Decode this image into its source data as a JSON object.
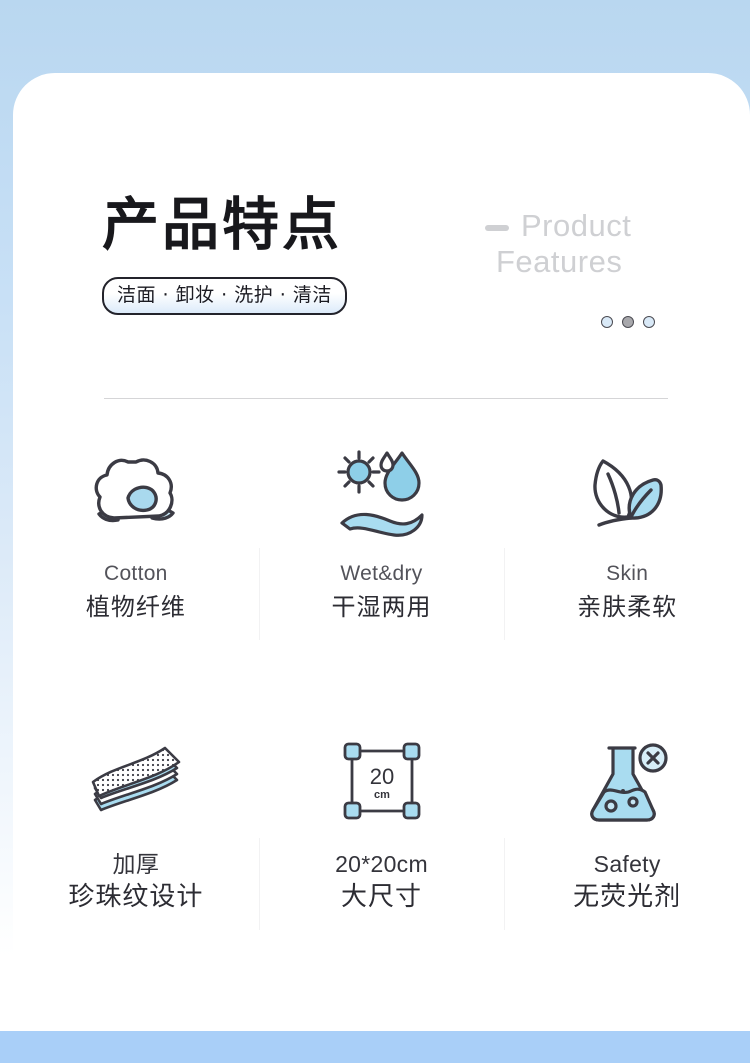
{
  "colors": {
    "page_gradient_top": "#b9d7f0",
    "page_gradient_bottom": "#ffffff",
    "bottom_band": "#a9cff8",
    "card": "#ffffff",
    "accent_blue": "#9ed2ea",
    "accent_blue_light": "#c6e6f4",
    "outline_dark": "#3b3b44",
    "title_text": "#18181c",
    "title_en_text": "#cfd0d3",
    "divider": "#d5d5d7"
  },
  "header": {
    "title_cn": "产品特点",
    "title_en_line1": "Product",
    "title_en_line2": "Features",
    "badge_text": "洁面 · 卸妆 · 洗护 · 清洁",
    "dots": [
      {
        "name": "dot-1",
        "style": "blue"
      },
      {
        "name": "dot-2",
        "style": "gray"
      },
      {
        "name": "dot-3",
        "style": "blue"
      }
    ]
  },
  "features": {
    "row1": [
      {
        "icon": "cotton-ball-icon",
        "label_en": "Cotton",
        "label_cn": "植物纤维"
      },
      {
        "icon": "sun-droplet-wave-icon",
        "label_en": "Wet&dry",
        "label_cn": "干湿两用"
      },
      {
        "icon": "leaves-icon",
        "label_en": "Skin",
        "label_cn": "亲肤柔软"
      }
    ],
    "row2": [
      {
        "icon": "towel-stack-icon",
        "label_en": "加厚",
        "label_cn": "珍珠纹设计"
      },
      {
        "icon": "size-square-icon",
        "label_en": "20*20cm",
        "label_cn": "大尺寸",
        "inner_number": "20",
        "inner_unit": "cm"
      },
      {
        "icon": "flask-no-fluorescent-icon",
        "label_en": "Safety",
        "label_cn": "无荧光剂"
      }
    ]
  }
}
